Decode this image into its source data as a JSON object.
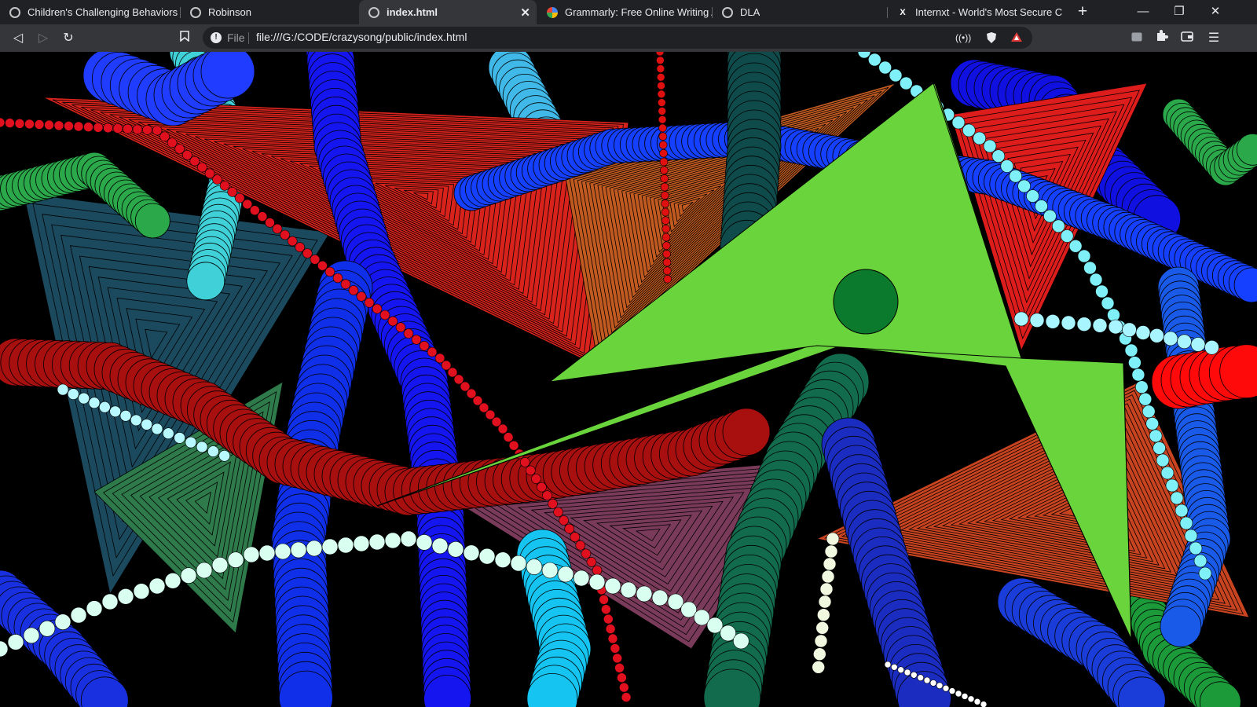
{
  "tabs": [
    {
      "title": "Children's Challenging Behaviors",
      "icon": "globe-icon",
      "active": false
    },
    {
      "title": "Robinson",
      "icon": "globe-icon",
      "active": false
    },
    {
      "title": "index.html",
      "icon": "globe-icon",
      "active": true
    },
    {
      "title": "Grammarly: Free Online Writing Assi",
      "icon": "grammarly-icon",
      "active": false
    },
    {
      "title": "DLA",
      "icon": "globe-icon",
      "active": false
    },
    {
      "title": "Internxt - World's Most Secure Cloud",
      "icon": "internxt-icon",
      "active": false
    }
  ],
  "window_controls": {
    "minimize": "—",
    "restore": "❐",
    "close": "✕"
  },
  "toolbar": {
    "back": "◁",
    "forward": "▷",
    "reload": "↻",
    "bookmark": "🔖",
    "info": "!",
    "scheme_label": "File",
    "url": "file:///G:/CODE/crazysong/public/index.html"
  },
  "colors": {
    "tabbar_bg": "#202124",
    "toolbar_bg": "#35363a",
    "omnibox_bg": "#202124",
    "text": "#e8eaed",
    "canvas_bg": "#000000"
  }
}
